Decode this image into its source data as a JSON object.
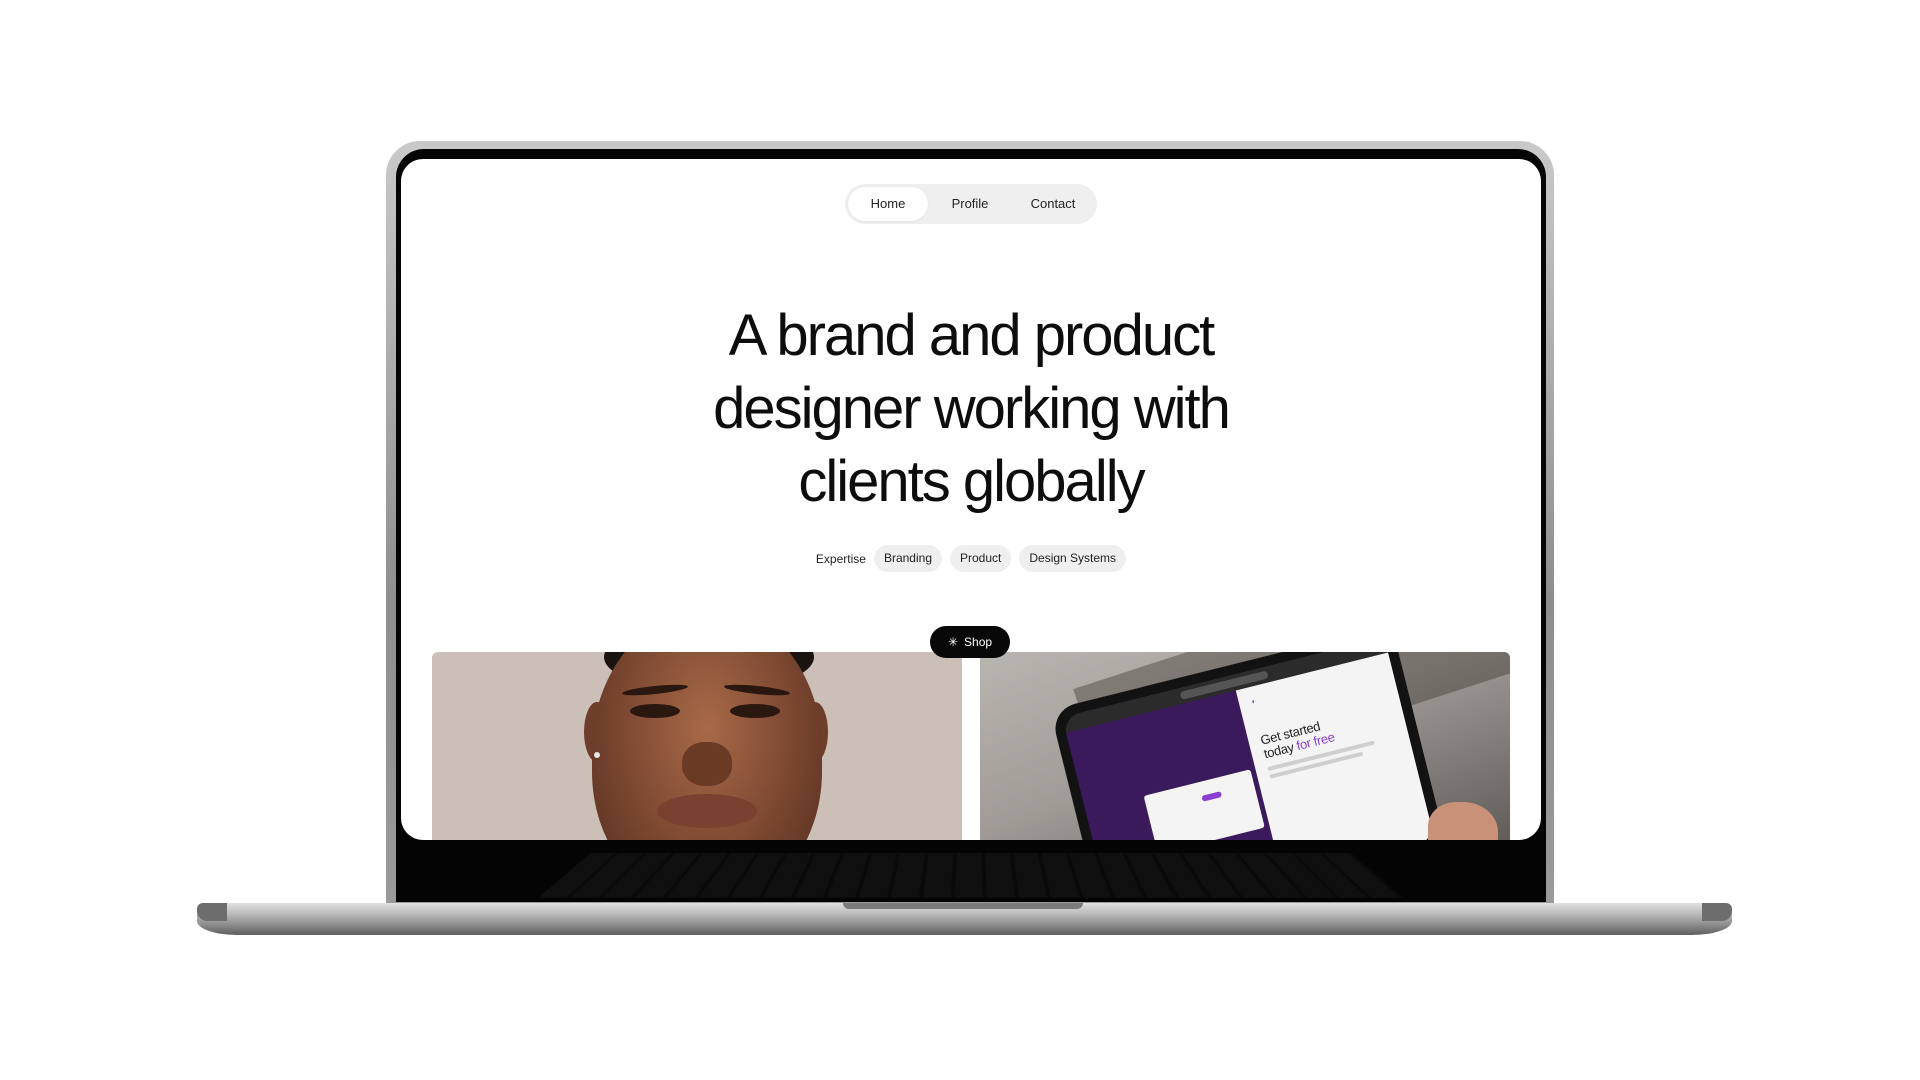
{
  "nav": {
    "items": [
      {
        "label": "Home",
        "active": true
      },
      {
        "label": "Profile",
        "active": false
      },
      {
        "label": "Contact",
        "active": false
      }
    ]
  },
  "hero": {
    "headline_lines": [
      "A brand and product",
      "designer working with",
      "clients globally"
    ]
  },
  "expertise": {
    "label": "Expertise",
    "tags": [
      "Branding",
      "Product",
      "Design Systems"
    ]
  },
  "shop_button": {
    "label": "Shop",
    "icon": "asterisk-icon"
  },
  "tablet_screen": {
    "cta_line1": "Get started",
    "cta_line2_prefix": "today",
    "cta_line2_accent": "for free"
  },
  "colors": {
    "background": "#ffffff",
    "nav_bg": "#efefef",
    "tag_bg": "#efefef",
    "shop_bg": "#080808",
    "accent_purple": "#8a3fd0"
  }
}
